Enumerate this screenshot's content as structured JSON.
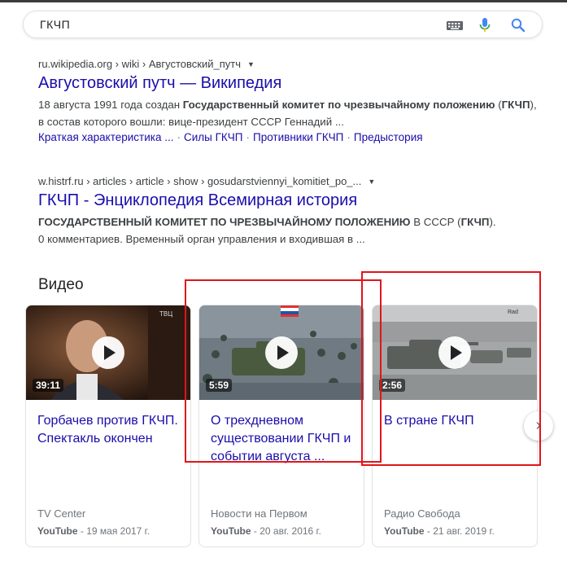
{
  "search": {
    "query": "ГКЧП"
  },
  "results": [
    {
      "cite": "ru.wikipedia.org › wiki › Августовский_путч",
      "title": "Августовский путч — Википедия",
      "snippet_pre": "18 августа 1991 года создан ",
      "snippet_bold1": "Государственный комитет по чрезвычайному положению",
      "snippet_mid": " (",
      "snippet_bold2": "ГКЧП",
      "snippet_post": "), в состав которого вошли: вице-президент СССР Геннадий ...",
      "sitelinks": [
        "Краткая характеристика ...",
        "Силы ГКЧП",
        "Противники ГКЧП",
        "Предыстория"
      ]
    },
    {
      "cite": "w.histrf.ru › articles › article › show › gosudarstviennyi_komitiet_po_...",
      "title": "ГКЧП - Энциклопедия Всемирная история",
      "snippet_bold1": "ГОСУДАРСТВЕННЫЙ КОМИТЕТ ПО ЧРЕЗВЫЧАЙНОМУ ПОЛОЖЕНИЮ",
      "snippet_mid": " В СССР (",
      "snippet_bold2": "ГКЧП",
      "snippet_post": ").",
      "snippet_line2": "0 комментариев. Временный орган управления и входившая в ..."
    }
  ],
  "videos": {
    "heading": "Видео",
    "items": [
      {
        "duration": "39:11",
        "title": "Горбачев против ГКЧП. Спектакль окончен",
        "source": "TV Center",
        "platform": "YouTube",
        "date": "19 мая 2017 г.",
        "channel_logo": "ТВЦ"
      },
      {
        "duration": "5:59",
        "title": "О трехдневном существовании ГКЧП и событии августа ...",
        "source": "Новости на Первом",
        "platform": "YouTube",
        "date": "20 авг. 2016 г."
      },
      {
        "duration": "2:56",
        "title": "В стране ГКЧП",
        "source": "Радио Свобода",
        "platform": "YouTube",
        "date": "21 авг. 2019 г.",
        "channel_logo": "Rad"
      }
    ],
    "next_icon": "chevron-right-icon"
  },
  "colors": {
    "link": "#1a0dab",
    "highlight": "#e0151b",
    "text_secondary": "#70757a"
  }
}
